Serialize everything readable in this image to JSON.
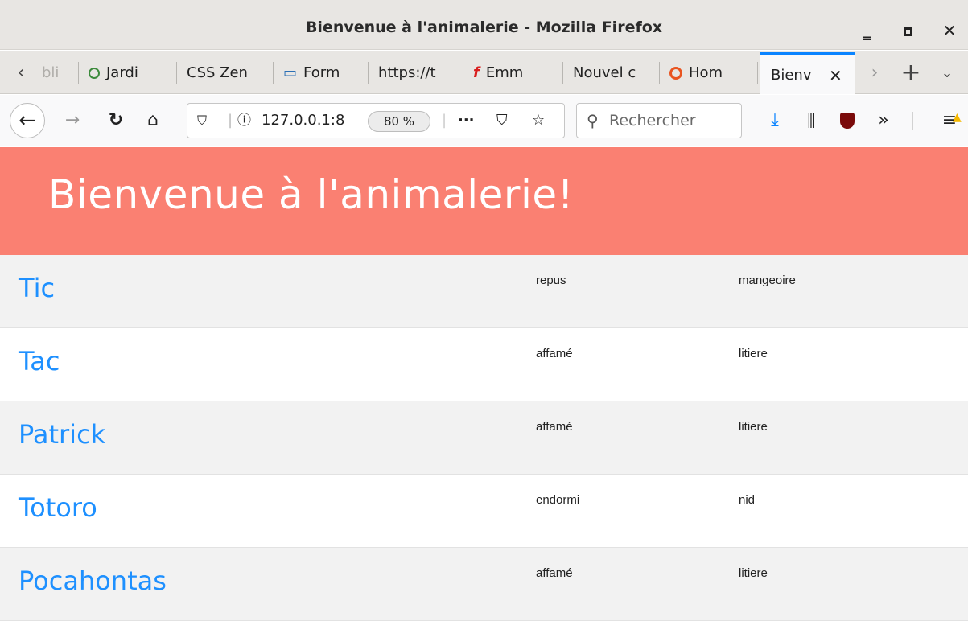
{
  "window": {
    "title": "Bienvenue à l'animalerie - Mozilla Firefox"
  },
  "tabs": [
    {
      "label": "bli",
      "icon": "chevron-left-icon"
    },
    {
      "label": "Jardi",
      "icon": "circle-icon"
    },
    {
      "label": "CSS Zen",
      "icon": ""
    },
    {
      "label": "Form",
      "icon": "book-icon"
    },
    {
      "label": "https://t",
      "icon": ""
    },
    {
      "label": "Emm",
      "icon": "flash-icon"
    },
    {
      "label": "Nouvel c",
      "icon": ""
    },
    {
      "label": "Hom",
      "icon": "ubuntu-icon"
    },
    {
      "label": "Bienv",
      "icon": "",
      "active": true
    }
  ],
  "navbar": {
    "url": "127.0.0.1:8",
    "zoom": "80 %",
    "search_placeholder": "Rechercher"
  },
  "page": {
    "heading": "Bienvenue à l'animalerie!",
    "animals": [
      {
        "name": "Tic",
        "state": "repus",
        "place": "mangeoire"
      },
      {
        "name": "Tac",
        "state": "affamé",
        "place": "litiere"
      },
      {
        "name": "Patrick",
        "state": "affamé",
        "place": "litiere"
      },
      {
        "name": "Totoro",
        "state": "endormi",
        "place": "nid"
      },
      {
        "name": "Pocahontas",
        "state": "affamé",
        "place": "litiere"
      }
    ]
  },
  "colors": {
    "banner": "#fa8072",
    "link": "#1e90ff",
    "alt_row": "#f2f2f2"
  }
}
